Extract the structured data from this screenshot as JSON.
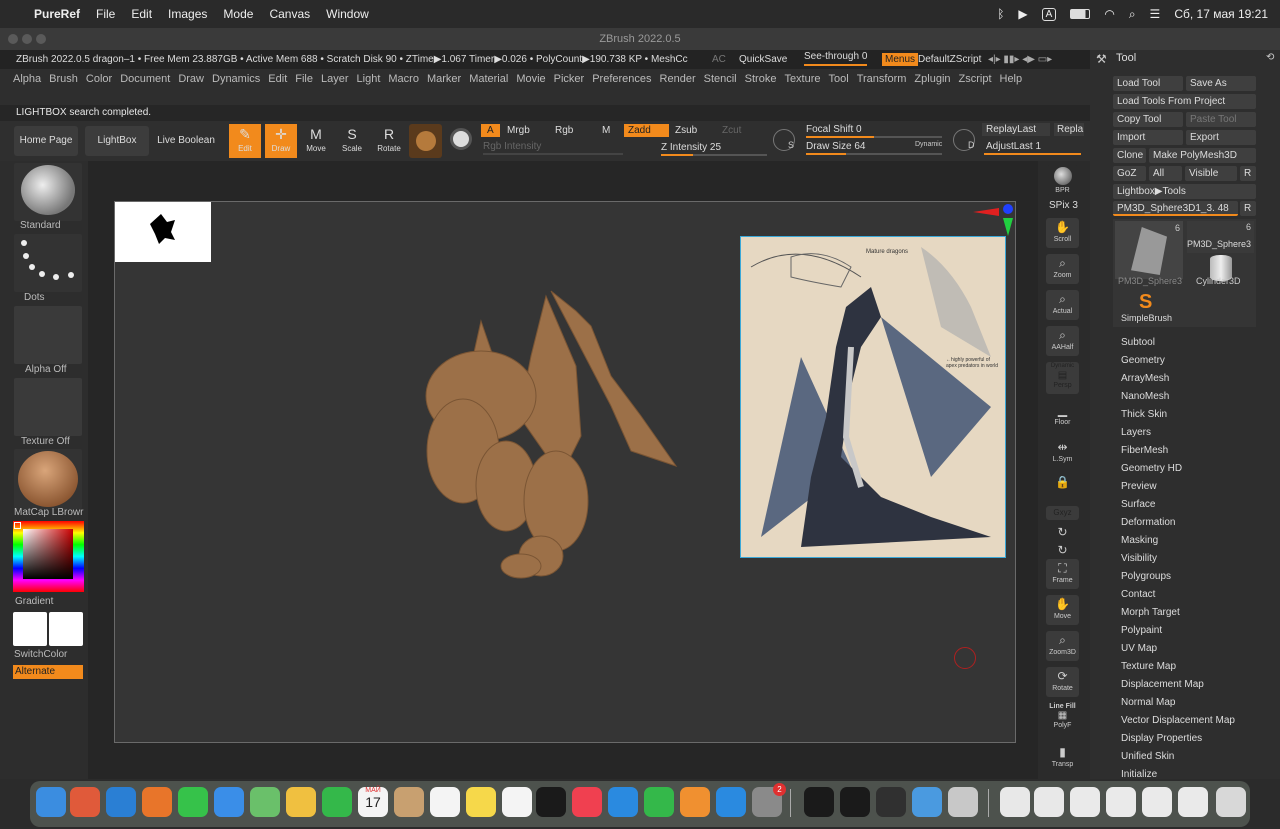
{
  "macbar": {
    "app": "PureRef",
    "menus": [
      "File",
      "Edit",
      "Images",
      "Mode",
      "Canvas",
      "Window"
    ],
    "lang": "A",
    "datetime": "Сб, 17 мая  19:21"
  },
  "window": {
    "title": "ZBrush 2022.0.5"
  },
  "info": {
    "text": "ZBrush 2022.0.5 dragon–1    • Free Mem 23.887GB • Active Mem 688 • Scratch Disk 90  •  ZTime▶1.067 Timer▶0.026 • PolyCount▶190.738 KP  • MeshCc",
    "ac": "AC",
    "quicksave": "QuickSave",
    "seethrough": "See-through  0",
    "menus": "Menus",
    "script": "DefaultZScript"
  },
  "menus": [
    "Alpha",
    "Brush",
    "Color",
    "Document",
    "Draw",
    "Dynamics",
    "Edit",
    "File",
    "Layer",
    "Light",
    "Macro",
    "Marker",
    "Material",
    "Movie",
    "Picker",
    "Preferences",
    "Render",
    "Stencil",
    "Stroke",
    "Texture",
    "Tool",
    "Transform",
    "Zplugin",
    "Zscript",
    "Help"
  ],
  "status": "LIGHTBOX search completed.",
  "toolbar": {
    "home": "Home Page",
    "lightbox": "LightBox",
    "liveboolean": "Live Boolean",
    "edit": "Edit",
    "draw": "Draw",
    "move": "Move",
    "scale": "Scale",
    "rotate": "Rotate",
    "a": "A",
    "mrgb": "Mrgb",
    "rgb": "Rgb",
    "m": "M",
    "zadd": "Zadd",
    "zsub": "Zsub",
    "zcut": "Zcut",
    "rgbint": "Rgb Intensity",
    "zint": "Z Intensity 25",
    "focal": "Focal Shift 0",
    "drawsize": "Draw Size 64",
    "dynamic": "Dynamic",
    "s": "S",
    "d": "D",
    "replay": "ReplayLast",
    "repla": "Repla",
    "adjust": "AdjustLast 1"
  },
  "left": {
    "standard": "Standard",
    "dots": "Dots",
    "alphaoff": "Alpha Off",
    "textureoff": "Texture Off",
    "matcap": "MatCap LBrowr",
    "gradient": "Gradient",
    "switchcolor": "SwitchColor",
    "alternate": "Alternate"
  },
  "right": {
    "bpr": "BPR",
    "spix": "SPix 3",
    "scroll": "Scroll",
    "zoom": "Zoom",
    "actual": "Actual",
    "aahalf": "AAHalf",
    "dynamic": "Dynamic",
    "persp": "Persp",
    "floor": "Floor",
    "lsym": "L.Sym",
    "xyz": "Gxyz",
    "frame": "Frame",
    "move": "Move",
    "zoom3d": "Zoom3D",
    "rotate": "Rotate",
    "linefill": "Line Fill",
    "polyf": "PolyF",
    "transp": "Transp"
  },
  "tool": {
    "title": "Tool",
    "load": "Load Tool",
    "saveas": "Save As",
    "loadproject": "Load Tools From Project",
    "copy": "Copy Tool",
    "paste": "Paste Tool",
    "import": "Import",
    "export": "Export",
    "clone": "Clone",
    "makepoly": "Make PolyMesh3D",
    "goz": "GoZ",
    "all": "All",
    "visible": "Visible",
    "r": "R",
    "lightbox": "Lightbox▶Tools",
    "current": "PM3D_Sphere3D1_3. 48",
    "t1": "PM3D_Sphere3",
    "t2": "PM3D_Sphere3",
    "t3": "Cylinder3D",
    "t4": "SimpleBrush",
    "n1": "6",
    "n2": "6"
  },
  "subpalettes": [
    "Subtool",
    "Geometry",
    "ArrayMesh",
    "NanoMesh",
    "Thick Skin",
    "Layers",
    "FiberMesh",
    "Geometry HD",
    "Preview",
    "Surface",
    "Deformation",
    "Masking",
    "Visibility",
    "Polygroups",
    "Contact",
    "Morph Target",
    "Polypaint",
    "UV Map",
    "Texture Map",
    "Displacement Map",
    "Normal Map",
    "Vector Displacement Map",
    "Display Properties",
    "Unified Skin",
    "Initialize"
  ],
  "ref": {
    "note1": "Mature dragons",
    "note2": "←highly powerful of\napex predators in world"
  },
  "dock": {
    "calendar_month": "МАЙ",
    "calendar_day": "17",
    "badge": "2"
  }
}
